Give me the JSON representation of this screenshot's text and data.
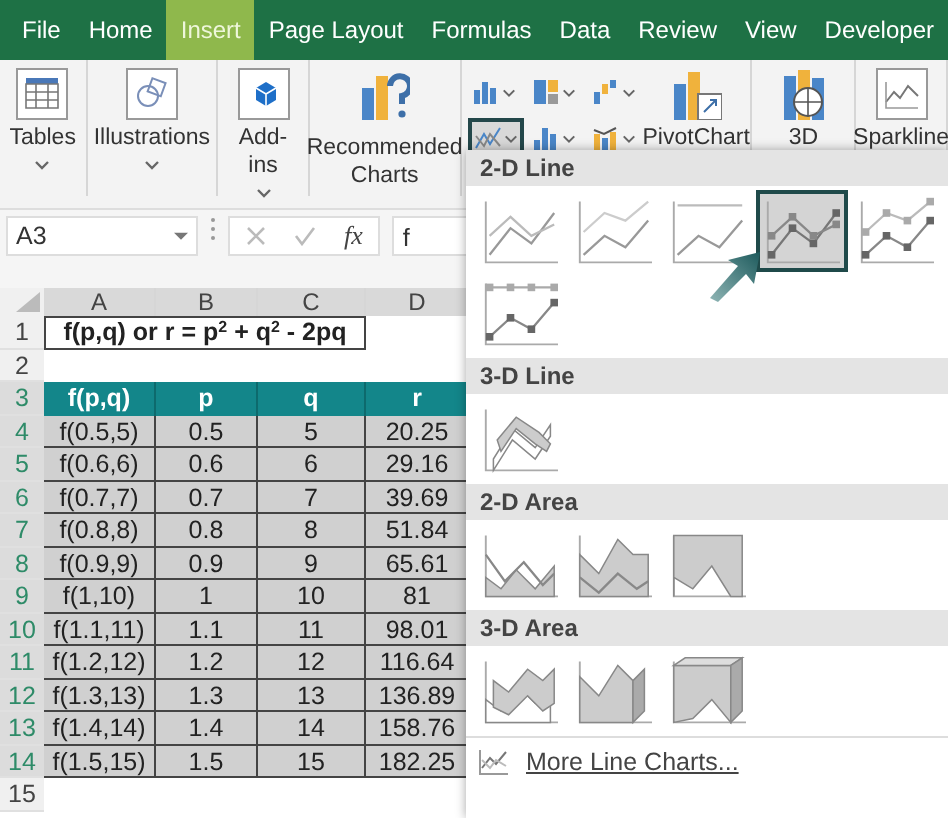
{
  "ribbon_tabs": [
    {
      "label": "File",
      "selected": false
    },
    {
      "label": "Home",
      "selected": false
    },
    {
      "label": "Insert",
      "selected": true
    },
    {
      "label": "Page Layout",
      "selected": false
    },
    {
      "label": "Formulas",
      "selected": false
    },
    {
      "label": "Data",
      "selected": false
    },
    {
      "label": "Review",
      "selected": false
    },
    {
      "label": "View",
      "selected": false
    },
    {
      "label": "Developer",
      "selected": false
    }
  ],
  "ribbon_groups": [
    {
      "kind": "tables",
      "label": "Tables",
      "menu": true
    },
    {
      "kind": "illustrations",
      "label": "Illustrations",
      "menu": true
    },
    {
      "kind": "addins",
      "label": "Add-ins",
      "menu": true
    },
    {
      "kind": "recommended",
      "label": "Recommended Charts",
      "menu": false
    }
  ],
  "chart_buttons": [
    {
      "kind": "column",
      "selected": false
    },
    {
      "kind": "hierarchy",
      "selected": false
    },
    {
      "kind": "waterfall",
      "selected": false
    },
    {
      "kind": "line",
      "selected": true
    },
    {
      "kind": "statistic",
      "selected": false
    },
    {
      "kind": "combo",
      "selected": false
    }
  ],
  "ribbon_groups_right": [
    {
      "kind": "pivotchart",
      "label": "PivotChart"
    },
    {
      "kind": "map3d",
      "label": "3D"
    },
    {
      "kind": "sparklines",
      "label": "Sparkline"
    }
  ],
  "formula_bar": {
    "name_box": "A3",
    "function_button": "fx",
    "formula": "f"
  },
  "sheet": {
    "columns": [
      {
        "label": "A",
        "selected": true
      },
      {
        "label": "B",
        "selected": true
      },
      {
        "label": "C",
        "selected": true
      },
      {
        "label": "D",
        "selected": true
      }
    ],
    "rows": [
      {
        "number": "1",
        "selected": false,
        "kind": "title",
        "cells": [
          "f(p,q) or r = p$^{2}$ + q$^{2}$ - 2pq"
        ]
      },
      {
        "number": "2",
        "selected": false,
        "kind": "blank",
        "cells": []
      },
      {
        "number": "3",
        "selected": true,
        "kind": "header",
        "cells": [
          "f(p,q)",
          "p",
          "q",
          "r"
        ]
      },
      {
        "number": "4",
        "selected": true,
        "kind": "data",
        "cells": [
          "f(0.5,5)",
          "0.5",
          "5",
          "20.25"
        ]
      },
      {
        "number": "5",
        "selected": true,
        "kind": "data",
        "cells": [
          "f(0.6,6)",
          "0.6",
          "6",
          "29.16"
        ]
      },
      {
        "number": "6",
        "selected": true,
        "kind": "data",
        "cells": [
          "f(0.7,7)",
          "0.7",
          "7",
          "39.69"
        ]
      },
      {
        "number": "7",
        "selected": true,
        "kind": "data",
        "cells": [
          "f(0.8,8)",
          "0.8",
          "8",
          "51.84"
        ]
      },
      {
        "number": "8",
        "selected": true,
        "kind": "data",
        "cells": [
          "f(0.9,9)",
          "0.9",
          "9",
          "65.61"
        ]
      },
      {
        "number": "9",
        "selected": true,
        "kind": "data",
        "cells": [
          "f(1,10)",
          "1",
          "10",
          "81"
        ]
      },
      {
        "number": "10",
        "selected": true,
        "kind": "data",
        "cells": [
          "f(1.1,11)",
          "1.1",
          "11",
          "98.01"
        ]
      },
      {
        "number": "11",
        "selected": true,
        "kind": "data",
        "cells": [
          "f(1.2,12)",
          "1.2",
          "12",
          "116.64"
        ]
      },
      {
        "number": "12",
        "selected": true,
        "kind": "data",
        "cells": [
          "f(1.3,13)",
          "1.3",
          "13",
          "136.89"
        ]
      },
      {
        "number": "13",
        "selected": true,
        "kind": "data",
        "cells": [
          "f(1.4,14)",
          "1.4",
          "14",
          "158.76"
        ]
      },
      {
        "number": "14",
        "selected": true,
        "kind": "data",
        "cells": [
          "f(1.5,15)",
          "1.5",
          "15",
          "182.25"
        ]
      },
      {
        "number": "15",
        "selected": false,
        "kind": "blank",
        "cells": []
      }
    ]
  },
  "gallery": {
    "sections": [
      {
        "title": "2-D Line",
        "items": [
          {
            "kind": "line",
            "selected": false
          },
          {
            "kind": "stacked-line",
            "selected": false
          },
          {
            "kind": "full-line",
            "selected": false
          },
          {
            "kind": "line-markers",
            "selected": true
          },
          {
            "kind": "stacked-markers",
            "selected": false
          },
          {
            "kind": "full-markers",
            "selected": false
          }
        ]
      },
      {
        "title": "3-D Line",
        "items": [
          {
            "kind": "line-3d",
            "selected": false
          }
        ]
      },
      {
        "title": "2-D Area",
        "items": [
          {
            "kind": "area",
            "selected": false
          },
          {
            "kind": "stacked-area",
            "selected": false
          },
          {
            "kind": "full-area",
            "selected": false
          }
        ]
      },
      {
        "title": "3-D Area",
        "items": [
          {
            "kind": "area-3d",
            "selected": false
          },
          {
            "kind": "stacked-area-3d",
            "selected": false
          },
          {
            "kind": "full-area-3d",
            "selected": false
          }
        ]
      }
    ],
    "footer": "More Line Charts..."
  }
}
